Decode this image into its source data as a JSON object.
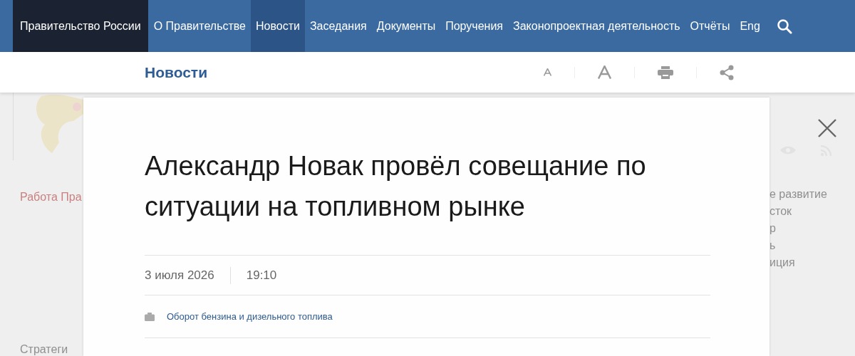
{
  "nav": {
    "items": [
      {
        "label": "Правительство России",
        "kind": "brand"
      },
      {
        "label": "О Правительстве",
        "kind": "link",
        "selected": false
      },
      {
        "label": "Новости",
        "kind": "link",
        "selected": true
      },
      {
        "label": "Заседания",
        "kind": "link",
        "selected": false
      },
      {
        "label": "Документы",
        "kind": "link",
        "selected": false
      },
      {
        "label": "Поручения",
        "kind": "link",
        "selected": false
      },
      {
        "label": "Законопроектная деятельность",
        "kind": "link",
        "selected": false
      },
      {
        "label": "Отчёты",
        "kind": "link",
        "selected": false
      },
      {
        "label": "Eng",
        "kind": "link",
        "selected": false
      }
    ]
  },
  "subheader": {
    "title": "Новости"
  },
  "background": {
    "left_links": [
      {
        "label": "Работа Пра",
        "kind": "accent"
      },
      {
        "label": "Стратеги",
        "kind": "plain"
      }
    ],
    "right_links": [
      "е развитие",
      "сток",
      "р",
      "ь",
      "иция"
    ]
  },
  "article": {
    "title": "Александр Новак провёл совещание по ситуации на топливном рынке",
    "date": "3 июля 2026",
    "time": "19:10",
    "tag": "Оборот бензина и дизельного топлива"
  }
}
